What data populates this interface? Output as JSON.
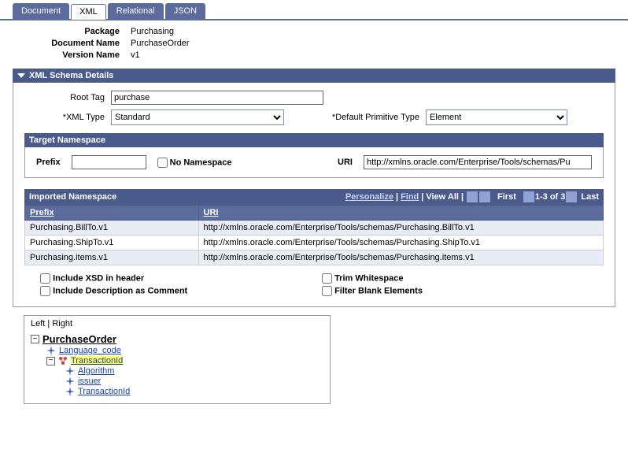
{
  "tabs": {
    "document": "Document",
    "xml": "XML",
    "relational": "Relational",
    "json": "JSON"
  },
  "meta": {
    "package_label": "Package",
    "package_value": "Purchasing",
    "docname_label": "Document Name",
    "docname_value": "PurchaseOrder",
    "version_label": "Version Name",
    "version_value": "v1"
  },
  "schema": {
    "header": "XML Schema Details",
    "root_tag_label": "Root Tag",
    "root_tag_value": "purchase",
    "xml_type_label": "XML Type",
    "xml_type_value": "Standard",
    "dpt_label": "Default Primitive Type",
    "dpt_value": "Element"
  },
  "target_ns": {
    "header": "Target Namespace",
    "prefix_label": "Prefix",
    "prefix_value": "",
    "no_ns_label": "No Namespace",
    "uri_label": "URI",
    "uri_value": "http://xmlns.oracle.com/Enterprise/Tools/schemas/Pu"
  },
  "imported": {
    "header": "Imported Namespace",
    "personalize": "Personalize",
    "find": "Find",
    "view_all": "View All",
    "first": "First",
    "range": "1-3 of 3",
    "last": "Last",
    "col_prefix": "Prefix",
    "col_uri": "URI",
    "rows": [
      {
        "prefix": "Purchasing.BillTo.v1",
        "uri": "http://xmlns.oracle.com/Enterprise/Tools/schemas/Purchasing.BillTo.v1"
      },
      {
        "prefix": "Purchasing.ShipTo.v1",
        "uri": "http://xmlns.oracle.com/Enterprise/Tools/schemas/Purchasing.ShipTo.v1"
      },
      {
        "prefix": "Purchasing.items.v1",
        "uri": "http://xmlns.oracle.com/Enterprise/Tools/schemas/Purchasing.items.v1"
      }
    ]
  },
  "options": {
    "include_xsd": "Include XSD in header",
    "include_desc": "Include Description as Comment",
    "trim_ws": "Trim Whitespace",
    "filter_blank": "Filter Blank Elements"
  },
  "tree": {
    "left": "Left",
    "right": "Right",
    "root": "PurchaseOrder",
    "language_code": "Language_code",
    "transaction_id": "TransactionId",
    "algorithm": "Algorithm",
    "issuer": "issuer",
    "transaction_id2": "TransactionId"
  }
}
